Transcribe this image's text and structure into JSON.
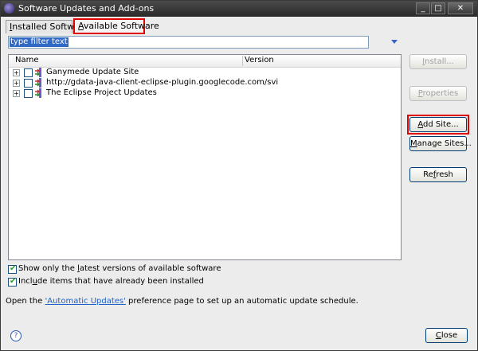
{
  "window": {
    "title": "Software Updates and Add-ons",
    "controls": {
      "minimize": "_",
      "maximize": "□",
      "close": "✕"
    }
  },
  "tabs": [
    {
      "pre": "",
      "mnemonic": "I",
      "post": "nstalled Software"
    },
    {
      "pre": "",
      "mnemonic": "A",
      "post": "vailable Software"
    }
  ],
  "filter": {
    "value": "type filter text"
  },
  "table": {
    "columns": [
      "Name",
      "Version"
    ],
    "rows": [
      {
        "label": "Ganymede Update Site"
      },
      {
        "label": "http://gdata-java-client-eclipse-plugin.googlecode.com/svi"
      },
      {
        "label": "The Eclipse Project Updates"
      }
    ]
  },
  "options": [
    {
      "pre": "Show only the ",
      "mnemonic": "l",
      "post": "atest versions of available software",
      "checked": true
    },
    {
      "pre": "Incl",
      "mnemonic": "u",
      "post": "de items that have already been installed",
      "checked": true
    }
  ],
  "buttons": {
    "install": {
      "pre": "",
      "mnemonic": "I",
      "post": "nstall..."
    },
    "properties": {
      "pre": "",
      "mnemonic": "P",
      "post": "roperties"
    },
    "add_site": {
      "pre": "",
      "mnemonic": "A",
      "post": "dd Site..."
    },
    "manage_sites": {
      "pre": "",
      "mnemonic": "M",
      "post": "anage Sites..."
    },
    "refresh": {
      "pre": "Re",
      "mnemonic": "f",
      "post": "resh"
    },
    "close": {
      "pre": "",
      "mnemonic": "C",
      "post": "lose"
    }
  },
  "info": {
    "prefix": "Open the ",
    "link": "'Automatic Updates'",
    "suffix": " preference page to set up an automatic update schedule."
  },
  "help": {
    "glyph": "?"
  }
}
